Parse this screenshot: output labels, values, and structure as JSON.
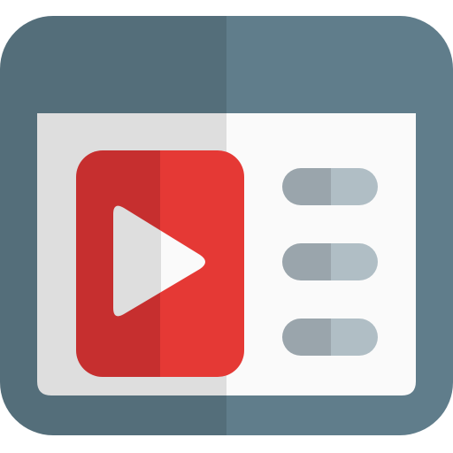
{
  "icon": {
    "name": "video-playlist-window-icon",
    "colors": {
      "frame_left": "#546E7A",
      "frame_right": "#607D8B",
      "panel_left": "#DEDEDE",
      "panel_right": "#FAFAFA",
      "player_left": "#C62F2F",
      "player_right": "#E53935",
      "play_left": "#DEDEDE",
      "play_right": "#FAFAFA",
      "list_left": "#9AA5AC",
      "list_right": "#B0BEC5"
    },
    "list_items": [
      {
        "name": "playlist-line-1"
      },
      {
        "name": "playlist-line-2"
      },
      {
        "name": "playlist-line-3"
      }
    ]
  }
}
